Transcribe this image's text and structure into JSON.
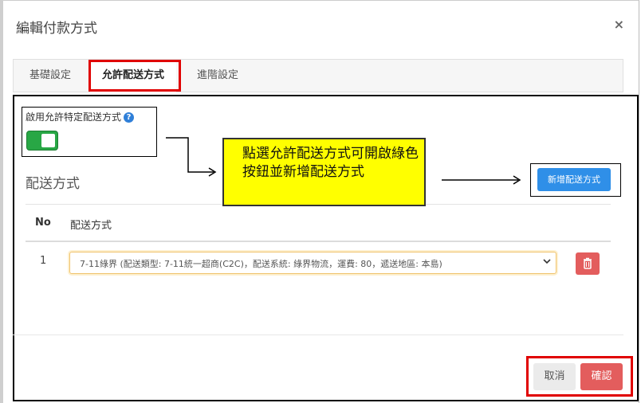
{
  "modal": {
    "title": "編輯付款方式",
    "close_label": "×"
  },
  "tabs": [
    {
      "label": "基礎設定",
      "active": false
    },
    {
      "label": "允許配送方式",
      "active": true
    },
    {
      "label": "進階設定",
      "active": false
    }
  ],
  "allowed_shipping": {
    "enable_label": "啟用允許特定配送方式",
    "help_icon": "?",
    "enabled": true,
    "section_title": "配送方式",
    "add_button_label": "新增配送方式",
    "table": {
      "headers": [
        "No",
        "配送方式"
      ],
      "rows": [
        {
          "no": "1",
          "method": "7-11綠界 (配送類型: 7-11統一超商(C2C)，配送系統: 綠界物流，運費: 80，遞送地區: 本島)"
        }
      ]
    }
  },
  "annotation": {
    "callout_text": "點選允許配送方式可開啟綠色按鈕並新增配送方式",
    "highlight_color": "#ffff00",
    "box_color": "#e00000"
  },
  "footer": {
    "cancel_label": "取消",
    "confirm_label": "確認"
  },
  "colors": {
    "toggle_on": "#28a745",
    "primary": "#2f8fe8",
    "danger": "#e35d5d"
  }
}
